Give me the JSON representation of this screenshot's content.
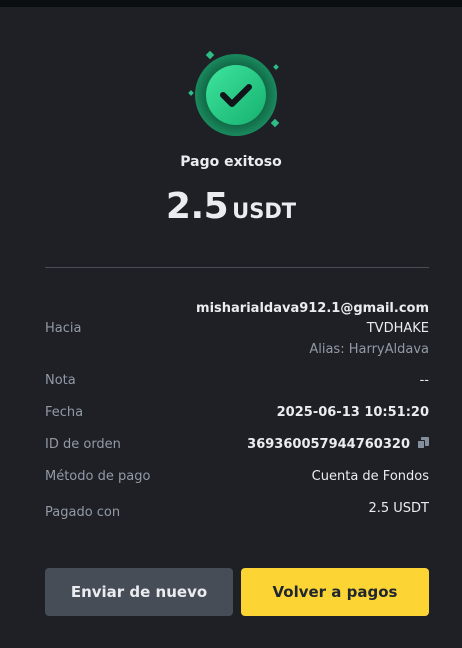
{
  "status": {
    "title": "Pago exitoso"
  },
  "amount": {
    "value": "2.5",
    "unit": "USDT"
  },
  "details": {
    "to_label": "Hacia",
    "to_email": "misharialdava912.1@gmail.com",
    "to_name": "TVDHAKE",
    "to_alias": "Alias: HarryAldava",
    "note_label": "Nota",
    "note_value": "--",
    "date_label": "Fecha",
    "date_value": "2025-06-13 10:51:20",
    "order_label": "ID de orden",
    "order_value": "369360057944760320",
    "method_label": "Método de pago",
    "method_value": "Cuenta de Fondos",
    "paid_label": "Pagado con",
    "paid_value": "2.5 USDT"
  },
  "actions": {
    "resend_label": "Enviar de nuevo",
    "back_label": "Volver a pagos"
  },
  "colors": {
    "accent": "#fcd535",
    "success": "#2ebd85",
    "background": "#1e2026"
  },
  "icons": {
    "status": "check-circle-icon",
    "copy": "copy-icon"
  }
}
